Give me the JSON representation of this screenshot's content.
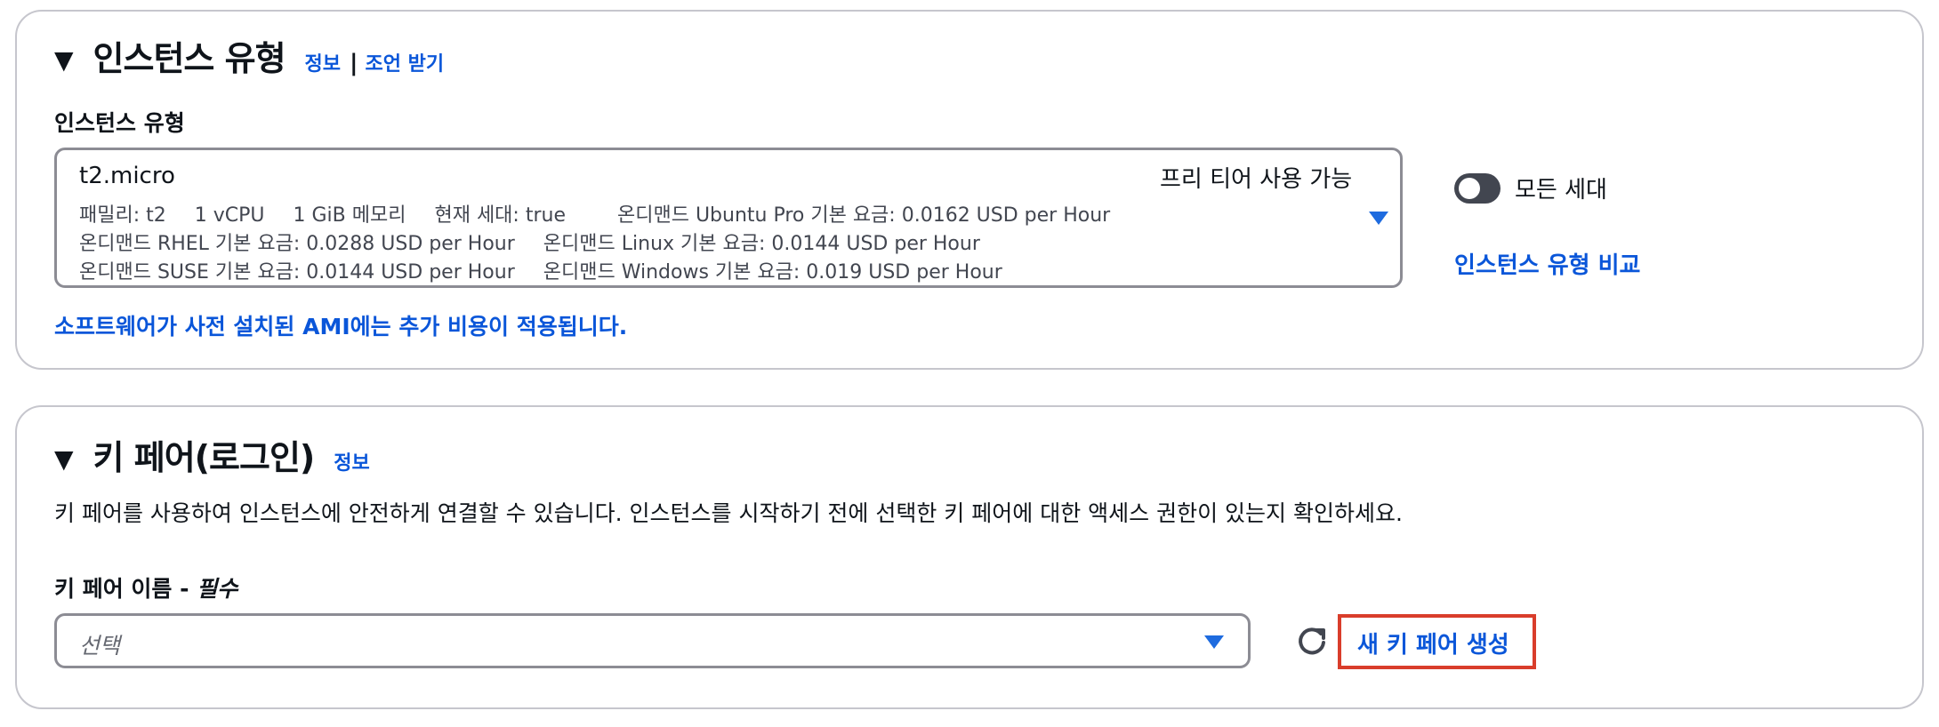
{
  "instance_section": {
    "title": "인스턴스 유형",
    "info_link": "정보",
    "separator": "|",
    "advice_link": "조언 받기",
    "field_label": "인스턴스 유형",
    "selected": {
      "name": "t2.micro",
      "free_tier": "프리 티어 사용 가능",
      "family": "패밀리: t2",
      "vcpu": "1 vCPU",
      "memory": "1 GiB 메모리",
      "current_gen": "현재 세대: true",
      "ubuntu_price": "온디맨드 Ubuntu Pro 기본 요금: 0.0162 USD per Hour",
      "rhel_price": "온디맨드 RHEL 기본 요금: 0.0288 USD per Hour",
      "linux_price": "온디맨드 Linux 기본 요금: 0.0144 USD per Hour",
      "suse_price": "온디맨드 SUSE 기본 요금: 0.0144 USD per Hour",
      "windows_price": "온디맨드 Windows 기본 요금: 0.019 USD per Hour"
    },
    "ami_note": "소프트웨어가 사전 설치된 AMI에는 추가 비용이 적용됩니다.",
    "all_generations_label": "모든 세대",
    "all_generations_on": false,
    "compare_link": "인스턴스 유형 비교"
  },
  "keypair_section": {
    "title": "키 페어(로그인)",
    "info_link": "정보",
    "description": "키 페어를 사용하여 인스턴스에 안전하게 연결할 수 있습니다. 인스턴스를 시작하기 전에 선택한 키 페어에 대한 액세스 권한이 있는지 확인하세요.",
    "field_label": "키 페어 이름 - ",
    "required_label": "필수",
    "select_placeholder": "선택",
    "create_link": "새 키 페어 생성"
  },
  "colors": {
    "link": "#0a56d9",
    "highlight_box": "#d93d2b",
    "toggle_off": "#424650"
  }
}
